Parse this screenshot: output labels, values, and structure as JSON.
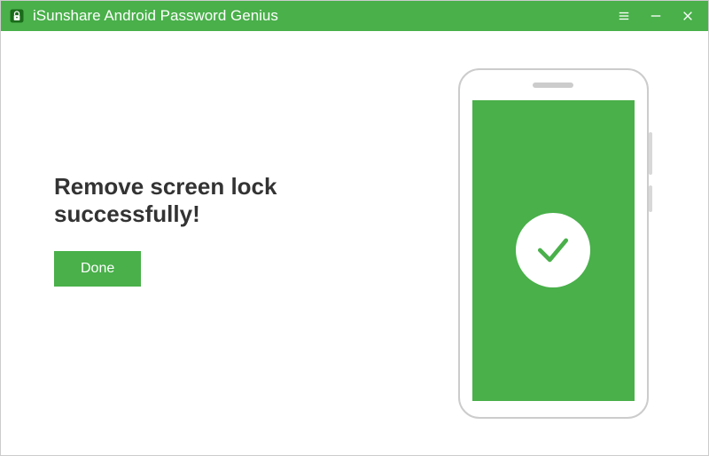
{
  "app": {
    "title": "iSunshare Android Password Genius"
  },
  "main": {
    "heading": "Remove screen lock successfully!",
    "done_label": "Done"
  },
  "colors": {
    "brand": "#49b04a"
  }
}
